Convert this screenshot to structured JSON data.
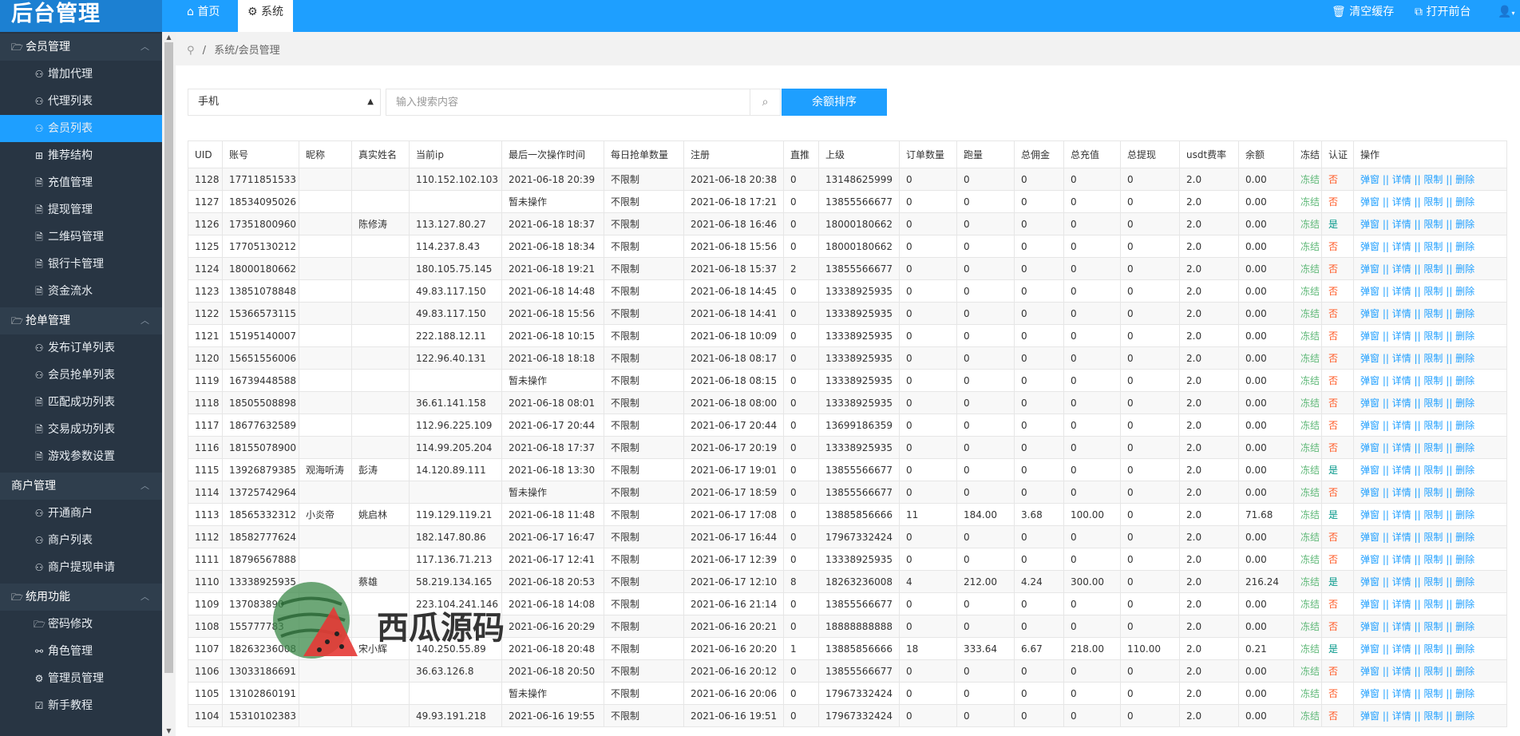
{
  "app": {
    "title": "后台管理"
  },
  "top_tabs": [
    {
      "label": "首页",
      "icon": "home-icon"
    },
    {
      "label": "系统",
      "icon": "gear-icon"
    }
  ],
  "top_right": {
    "clear_cache": "清空缓存",
    "open_frontend": "打开前台",
    "user_icon": "user-icon"
  },
  "sidebar": {
    "groups": [
      {
        "label": "会员管理",
        "icon": "folder-open-icon",
        "items": [
          {
            "label": "增加代理",
            "icon": "user-icon"
          },
          {
            "label": "代理列表",
            "icon": "user-icon"
          },
          {
            "label": "会员列表",
            "icon": "user-icon",
            "active": true
          },
          {
            "label": "推荐结构",
            "icon": "grid-icon"
          },
          {
            "label": "充值管理",
            "icon": "file-icon"
          },
          {
            "label": "提现管理",
            "icon": "file-icon"
          },
          {
            "label": "二维码管理",
            "icon": "file-icon"
          },
          {
            "label": "银行卡管理",
            "icon": "file-icon"
          },
          {
            "label": "资金流水",
            "icon": "file-icon"
          }
        ]
      },
      {
        "label": "抢单管理",
        "icon": "folder-open-icon",
        "items": [
          {
            "label": "发布订单列表",
            "icon": "user-icon"
          },
          {
            "label": "会员抢单列表",
            "icon": "user-icon"
          },
          {
            "label": "匹配成功列表",
            "icon": "file-icon"
          },
          {
            "label": "交易成功列表",
            "icon": "file-icon"
          },
          {
            "label": "游戏参数设置",
            "icon": "file-icon"
          }
        ]
      },
      {
        "label": "商户管理",
        "icon": "",
        "items": [
          {
            "label": "开通商户",
            "icon": "user-icon"
          },
          {
            "label": "商户列表",
            "icon": "user-icon"
          },
          {
            "label": "商户提现申请",
            "icon": "user-icon"
          }
        ]
      },
      {
        "label": "统用功能",
        "icon": "folder-open-icon",
        "items": [
          {
            "label": "密码修改",
            "icon": "folder-open-icon"
          },
          {
            "label": "角色管理",
            "icon": "org-icon"
          },
          {
            "label": "管理员管理",
            "icon": "gear-icon"
          },
          {
            "label": "新手教程",
            "icon": "checkbox-icon"
          }
        ]
      }
    ]
  },
  "breadcrumb": {
    "separator": "/",
    "path": "系统/会员管理"
  },
  "search": {
    "select_value": "手机",
    "placeholder": "输入搜索内容",
    "sort_button": "余额排序"
  },
  "table": {
    "headers": [
      "UID",
      "账号",
      "昵称",
      "真实姓名",
      "当前ip",
      "最后一次操作时间",
      "每日抢单数量",
      "注册",
      "直推",
      "上级",
      "订单数量",
      "跑量",
      "总佣金",
      "总充值",
      "总提现",
      "usdt费率",
      "余额",
      "冻结",
      "认证",
      "操作"
    ],
    "ops_text": "弹窗 || 详情 || 限制 || 删除",
    "rows": [
      [
        "1128",
        "17711851533",
        "",
        "",
        "110.152.102.103",
        "2021-06-18 20:39",
        "不限制",
        "2021-06-18 20:38",
        "0",
        "13148625999",
        "0",
        "0",
        "0",
        "0",
        "0",
        "2.0",
        "0.00",
        "冻结",
        "否"
      ],
      [
        "1127",
        "18534095026",
        "",
        "",
        "",
        "暂未操作",
        "不限制",
        "2021-06-18 17:21",
        "0",
        "13855566677",
        "0",
        "0",
        "0",
        "0",
        "0",
        "2.0",
        "0.00",
        "冻结",
        "否"
      ],
      [
        "1126",
        "17351800960",
        "",
        "陈修涛",
        "113.127.80.27",
        "2021-06-18 18:37",
        "不限制",
        "2021-06-18 16:46",
        "0",
        "18000180662",
        "0",
        "0",
        "0",
        "0",
        "0",
        "2.0",
        "0.00",
        "冻结",
        "是"
      ],
      [
        "1125",
        "17705130212",
        "",
        "",
        "114.237.8.43",
        "2021-06-18 18:34",
        "不限制",
        "2021-06-18 15:56",
        "0",
        "18000180662",
        "0",
        "0",
        "0",
        "0",
        "0",
        "2.0",
        "0.00",
        "冻结",
        "否"
      ],
      [
        "1124",
        "18000180662",
        "",
        "",
        "180.105.75.145",
        "2021-06-18 19:21",
        "不限制",
        "2021-06-18 15:37",
        "2",
        "13855566677",
        "0",
        "0",
        "0",
        "0",
        "0",
        "2.0",
        "0.00",
        "冻结",
        "否"
      ],
      [
        "1123",
        "13851078848",
        "",
        "",
        "49.83.117.150",
        "2021-06-18 14:48",
        "不限制",
        "2021-06-18 14:45",
        "0",
        "13338925935",
        "0",
        "0",
        "0",
        "0",
        "0",
        "2.0",
        "0.00",
        "冻结",
        "否"
      ],
      [
        "1122",
        "15366573115",
        "",
        "",
        "49.83.117.150",
        "2021-06-18 15:56",
        "不限制",
        "2021-06-18 14:41",
        "0",
        "13338925935",
        "0",
        "0",
        "0",
        "0",
        "0",
        "2.0",
        "0.00",
        "冻结",
        "否"
      ],
      [
        "1121",
        "15195140007",
        "",
        "",
        "222.188.12.11",
        "2021-06-18 10:15",
        "不限制",
        "2021-06-18 10:09",
        "0",
        "13338925935",
        "0",
        "0",
        "0",
        "0",
        "0",
        "2.0",
        "0.00",
        "冻结",
        "否"
      ],
      [
        "1120",
        "15651556006",
        "",
        "",
        "122.96.40.131",
        "2021-06-18 18:18",
        "不限制",
        "2021-06-18 08:17",
        "0",
        "13338925935",
        "0",
        "0",
        "0",
        "0",
        "0",
        "2.0",
        "0.00",
        "冻结",
        "否"
      ],
      [
        "1119",
        "16739448588",
        "",
        "",
        "",
        "暂未操作",
        "不限制",
        "2021-06-18 08:15",
        "0",
        "13338925935",
        "0",
        "0",
        "0",
        "0",
        "0",
        "2.0",
        "0.00",
        "冻结",
        "否"
      ],
      [
        "1118",
        "18505508898",
        "",
        "",
        "36.61.141.158",
        "2021-06-18 08:01",
        "不限制",
        "2021-06-18 08:00",
        "0",
        "13338925935",
        "0",
        "0",
        "0",
        "0",
        "0",
        "2.0",
        "0.00",
        "冻结",
        "否"
      ],
      [
        "1117",
        "18677632589",
        "",
        "",
        "112.96.225.109",
        "2021-06-17 20:44",
        "不限制",
        "2021-06-17 20:44",
        "0",
        "13699186359",
        "0",
        "0",
        "0",
        "0",
        "0",
        "2.0",
        "0.00",
        "冻结",
        "否"
      ],
      [
        "1116",
        "18155078900",
        "",
        "",
        "114.99.205.204",
        "2021-06-18 17:37",
        "不限制",
        "2021-06-17 20:19",
        "0",
        "13338925935",
        "0",
        "0",
        "0",
        "0",
        "0",
        "2.0",
        "0.00",
        "冻结",
        "否"
      ],
      [
        "1115",
        "13926879385",
        "观海听涛",
        "彭涛",
        "14.120.89.111",
        "2021-06-18 13:30",
        "不限制",
        "2021-06-17 19:01",
        "0",
        "13855566677",
        "0",
        "0",
        "0",
        "0",
        "0",
        "2.0",
        "0.00",
        "冻结",
        "是"
      ],
      [
        "1114",
        "13725742964",
        "",
        "",
        "",
        "暂未操作",
        "不限制",
        "2021-06-17 18:59",
        "0",
        "13855566677",
        "0",
        "0",
        "0",
        "0",
        "0",
        "2.0",
        "0.00",
        "冻结",
        "否"
      ],
      [
        "1113",
        "18565332312",
        "小炎帝",
        "姚启林",
        "119.129.119.21",
        "2021-06-18 11:48",
        "不限制",
        "2021-06-17 17:08",
        "0",
        "13885856666",
        "11",
        "184.00",
        "3.68",
        "100.00",
        "0",
        "2.0",
        "71.68",
        "冻结",
        "是"
      ],
      [
        "1112",
        "18582777624",
        "",
        "",
        "182.147.80.86",
        "2021-06-17 16:47",
        "不限制",
        "2021-06-17 16:44",
        "0",
        "17967332424",
        "0",
        "0",
        "0",
        "0",
        "0",
        "2.0",
        "0.00",
        "冻结",
        "否"
      ],
      [
        "1111",
        "18796567888",
        "",
        "",
        "117.136.71.213",
        "2021-06-17 12:41",
        "不限制",
        "2021-06-17 12:39",
        "0",
        "13338925935",
        "0",
        "0",
        "0",
        "0",
        "0",
        "2.0",
        "0.00",
        "冻结",
        "否"
      ],
      [
        "1110",
        "13338925935",
        "",
        "蔡雄",
        "58.219.134.165",
        "2021-06-18 20:53",
        "不限制",
        "2021-06-17 12:10",
        "8",
        "18263236008",
        "4",
        "212.00",
        "4.24",
        "300.00",
        "0",
        "2.0",
        "216.24",
        "冻结",
        "是"
      ],
      [
        "1109",
        "137083890",
        "",
        "",
        "223.104.241.146",
        "2021-06-18 14:08",
        "不限制",
        "2021-06-16 21:14",
        "0",
        "13855566677",
        "0",
        "0",
        "0",
        "0",
        "0",
        "2.0",
        "0.00",
        "冻结",
        "否"
      ],
      [
        "1108",
        "155777783",
        "",
        "",
        "",
        "2021-06-16 20:29",
        "不限制",
        "2021-06-16 20:21",
        "0",
        "18888888888",
        "0",
        "0",
        "0",
        "0",
        "0",
        "2.0",
        "0.00",
        "冻结",
        "否"
      ],
      [
        "1107",
        "18263236008",
        "",
        "宋小辉",
        "140.250.55.89",
        "2021-06-18 20:48",
        "不限制",
        "2021-06-16 20:20",
        "1",
        "13885856666",
        "18",
        "333.64",
        "6.67",
        "218.00",
        "110.00",
        "2.0",
        "0.21",
        "冻结",
        "是"
      ],
      [
        "1106",
        "13033186691",
        "",
        "",
        "36.63.126.8",
        "2021-06-18 20:50",
        "不限制",
        "2021-06-16 20:12",
        "0",
        "13855566677",
        "0",
        "0",
        "0",
        "0",
        "0",
        "2.0",
        "0.00",
        "冻结",
        "否"
      ],
      [
        "1105",
        "13102860191",
        "",
        "",
        "",
        "暂未操作",
        "不限制",
        "2021-06-16 20:06",
        "0",
        "17967332424",
        "0",
        "0",
        "0",
        "0",
        "0",
        "2.0",
        "0.00",
        "冻结",
        "否"
      ],
      [
        "1104",
        "15310102383",
        "",
        "",
        "49.93.191.218",
        "2021-06-16 19:55",
        "不限制",
        "2021-06-16 19:51",
        "0",
        "17967332424",
        "0",
        "0",
        "0",
        "0",
        "0",
        "2.0",
        "0.00",
        "冻结",
        "否"
      ]
    ]
  },
  "watermark": {
    "text": "西瓜源码"
  },
  "colors": {
    "accent": "#1e9fff",
    "sidebar_bg": "#283543",
    "frozen": "#5fb878",
    "no": "#ff5722",
    "yes": "#009688"
  }
}
